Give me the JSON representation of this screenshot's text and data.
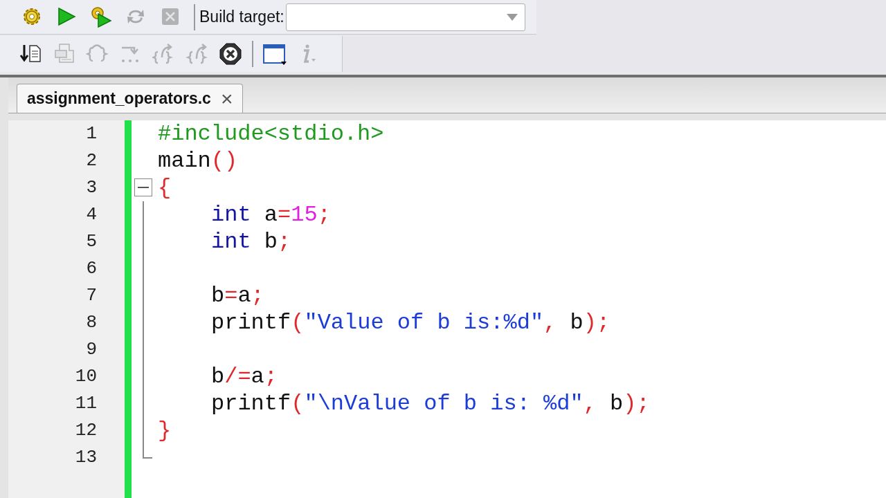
{
  "toolbar_1": {
    "buttons": [
      {
        "kind": "build",
        "disabled": false
      },
      {
        "kind": "run",
        "disabled": false
      },
      {
        "kind": "build_run",
        "disabled": false
      },
      {
        "kind": "rebuild",
        "disabled": true
      },
      {
        "kind": "abort",
        "disabled": true
      }
    ],
    "build_target": {
      "label": "Build target:"
    }
  },
  "toolbar_2": {
    "buttons": [
      {
        "kind": "step_into_file",
        "disabled": false
      },
      {
        "kind": "document",
        "disabled": true
      },
      {
        "kind": "step_braces",
        "disabled": true
      },
      {
        "kind": "next_line",
        "disabled": true
      },
      {
        "kind": "step_out",
        "disabled": true
      },
      {
        "kind": "step_back",
        "disabled": true
      },
      {
        "kind": "stop",
        "disabled": false
      },
      {
        "kind": "window",
        "disabled": false
      },
      {
        "kind": "info",
        "disabled": true
      }
    ]
  },
  "tabs": [
    {
      "label": "assignment_operators.c",
      "selected": true,
      "close": "×"
    }
  ],
  "editor": {
    "lines": [
      {
        "number": "1",
        "fold_box": false,
        "indented": false,
        "tokens": [
          {
            "kind": "preproc",
            "text": "#include<stdio.h>"
          }
        ]
      },
      {
        "number": "2",
        "fold_box": false,
        "indented": false,
        "tokens": [
          {
            "kind": "plain",
            "text": "main"
          },
          {
            "kind": "operator",
            "text": "()"
          }
        ]
      },
      {
        "number": "3",
        "fold_box": true,
        "indented": false,
        "tokens": [
          {
            "kind": "operator",
            "text": "{"
          }
        ]
      },
      {
        "number": "4",
        "fold_box": false,
        "indented": true,
        "tokens": [
          {
            "kind": "keyword",
            "text": "int"
          },
          {
            "kind": "plain",
            "text": " a"
          },
          {
            "kind": "operator",
            "text": "="
          },
          {
            "kind": "number",
            "text": "15"
          },
          {
            "kind": "operator",
            "text": ";"
          }
        ]
      },
      {
        "number": "5",
        "fold_box": false,
        "indented": true,
        "tokens": [
          {
            "kind": "keyword",
            "text": "int"
          },
          {
            "kind": "plain",
            "text": " b"
          },
          {
            "kind": "operator",
            "text": ";"
          }
        ]
      },
      {
        "number": "6",
        "fold_box": false
      },
      {
        "number": "7",
        "fold_box": false,
        "indented": true,
        "tokens": [
          {
            "kind": "plain",
            "text": "b"
          },
          {
            "kind": "operator",
            "text": "="
          },
          {
            "kind": "plain",
            "text": "a"
          },
          {
            "kind": "operator",
            "text": ";"
          }
        ]
      },
      {
        "number": "8",
        "fold_box": false,
        "indented": true,
        "tokens": [
          {
            "kind": "plain",
            "text": "printf"
          },
          {
            "kind": "operator",
            "text": "("
          },
          {
            "kind": "string",
            "text": "\"Value of b is:%d\""
          },
          {
            "kind": "operator",
            "text": ","
          },
          {
            "kind": "plain",
            "text": " b"
          },
          {
            "kind": "operator",
            "text": ");"
          }
        ]
      },
      {
        "number": "9",
        "fold_box": false
      },
      {
        "number": "10",
        "fold_box": false,
        "indented": true,
        "tokens": [
          {
            "kind": "plain",
            "text": "b"
          },
          {
            "kind": "operator",
            "text": "/="
          },
          {
            "kind": "plain",
            "text": "a"
          },
          {
            "kind": "operator",
            "text": ";"
          }
        ]
      },
      {
        "number": "11",
        "fold_box": false,
        "indented": true,
        "tokens": [
          {
            "kind": "plain",
            "text": "printf"
          },
          {
            "kind": "operator",
            "text": "("
          },
          {
            "kind": "string",
            "text": "\"\\nValue of b is: %d\""
          },
          {
            "kind": "operator",
            "text": ","
          },
          {
            "kind": "plain",
            "text": " b"
          },
          {
            "kind": "operator",
            "text": ");"
          }
        ]
      },
      {
        "number": "12",
        "fold_box": false,
        "indented": false,
        "tokens": [
          {
            "kind": "operator",
            "text": "}"
          }
        ]
      },
      {
        "number": "13",
        "fold_box": false
      }
    ]
  }
}
